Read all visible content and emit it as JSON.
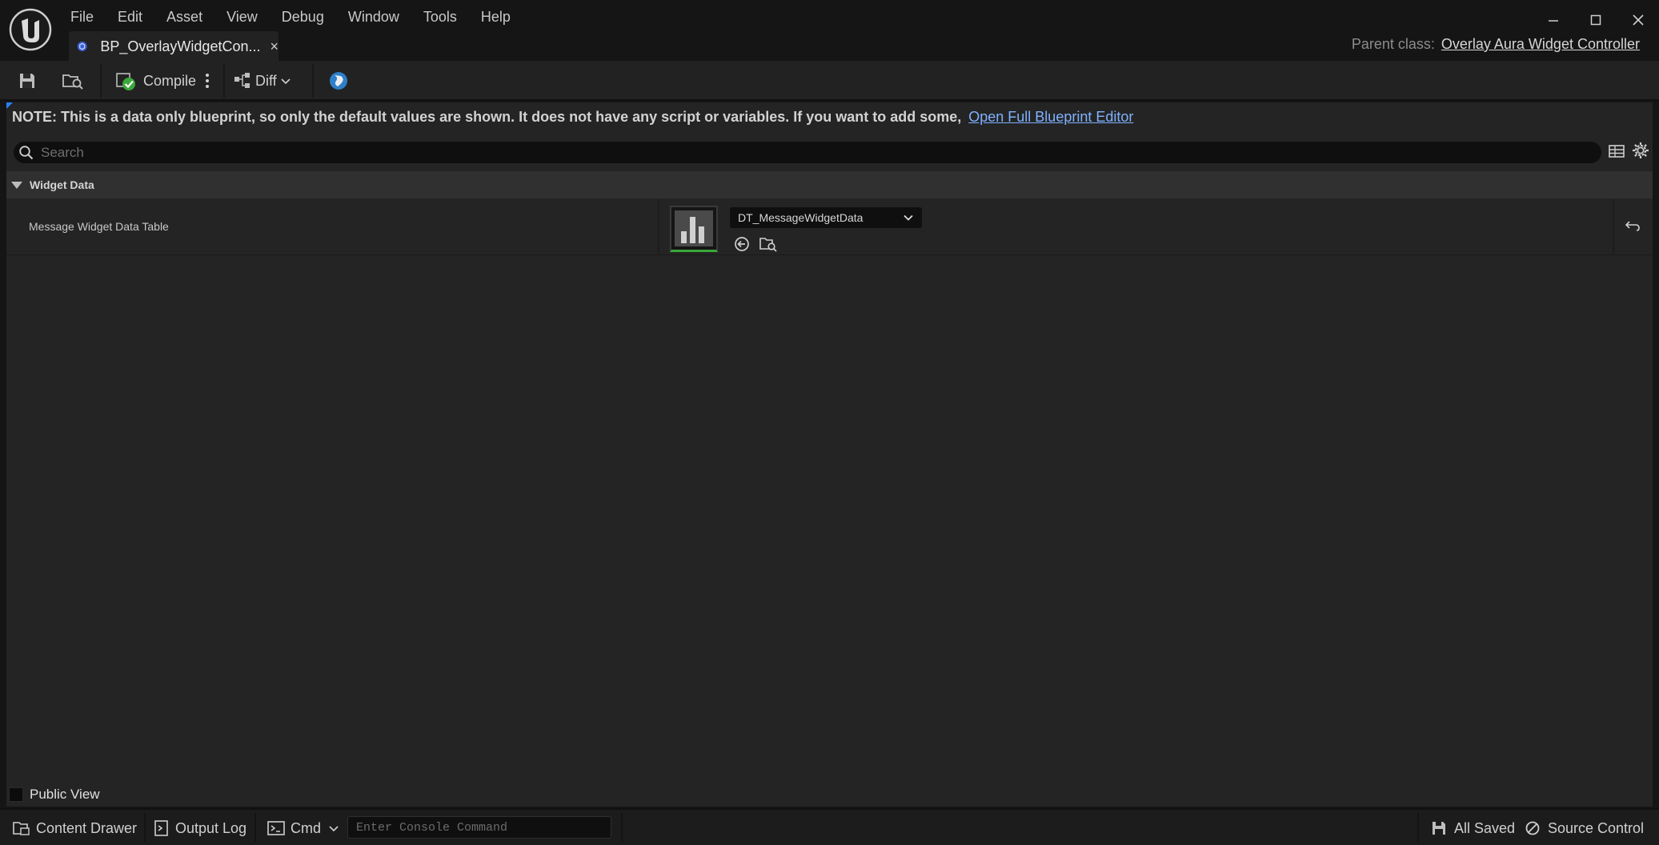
{
  "app": {
    "logo_icon": "unreal-engine-logo-icon"
  },
  "menu": {
    "items": [
      "File",
      "Edit",
      "Asset",
      "View",
      "Debug",
      "Window",
      "Tools",
      "Help"
    ]
  },
  "tab": {
    "title": "BP_OverlayWidgetCon...",
    "close": "×"
  },
  "parent_class": {
    "label": "Parent class:",
    "value": "Overlay Aura Widget Controller"
  },
  "toolbar": {
    "compile_label": "Compile",
    "diff_label": "Diff"
  },
  "panel": {
    "note": "NOTE: This is a data only blueprint, so only the default values are shown.  It does not have any script or variables.  If you want to add some,",
    "note_link": "Open Full Blueprint Editor",
    "search_placeholder": "Search",
    "category": "Widget Data",
    "property": {
      "name": "Message Widget Data Table",
      "value": "DT_MessageWidgetData"
    },
    "public_view_label": "Public View"
  },
  "statusbar": {
    "content_drawer": "Content Drawer",
    "output_log": "Output Log",
    "cmd": "Cmd",
    "console_placeholder": "Enter Console Command",
    "all_saved": "All Saved",
    "source_control": "Source Control"
  },
  "colors": {
    "background": "#151515",
    "panel": "#242424",
    "accent_link": "#7fb2ff",
    "compile_ok": "#3aa83a"
  }
}
